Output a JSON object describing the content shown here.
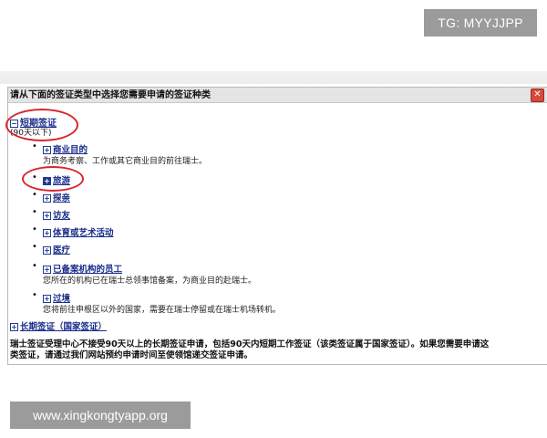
{
  "watermarks": {
    "tg": "TG: MYYJJPP",
    "url": "www.xingkongtyapp.org"
  },
  "dialog": {
    "title": "请从下面的签证类型中选择您需要申请的签证种类",
    "close_label": "✕",
    "short_term": {
      "toggle": "⊟",
      "label": "短期签证",
      "sub": "(90天以下)"
    },
    "items": [
      {
        "label": "商业目的",
        "note": "为商务考察、工作或其它商业目的前往瑞士。"
      },
      {
        "label": "旅游",
        "note": ""
      },
      {
        "label": "探亲",
        "note": ""
      },
      {
        "label": "访友",
        "note": ""
      },
      {
        "label": "体育或艺术活动",
        "note": ""
      },
      {
        "label": "医疗",
        "note": ""
      },
      {
        "label": "已备案机构的员工",
        "note": "您所在的机构已在瑞士总领事馆备案，为商业目的赴瑞士。"
      },
      {
        "label": "过境",
        "note": "您将前往申根区以外的国家，需要在瑞士停留或在瑞士机场转机。"
      }
    ],
    "long_term": {
      "toggle": "⊞",
      "label": "长期签证（国家签证）"
    },
    "footer_line1": "瑞士签证受理中心不接受90天以上的长期签证申请，包括90天内短期工作签证（该类签证属于国家签证）。如果您需要申请这",
    "footer_line2": "类签证，请通过我们网站预约申请时间至使领馆递交签证申请。"
  },
  "colors": {
    "link": "#1a2d8a",
    "annotation_ring": "#d9262b",
    "close": "#d64a3c"
  }
}
